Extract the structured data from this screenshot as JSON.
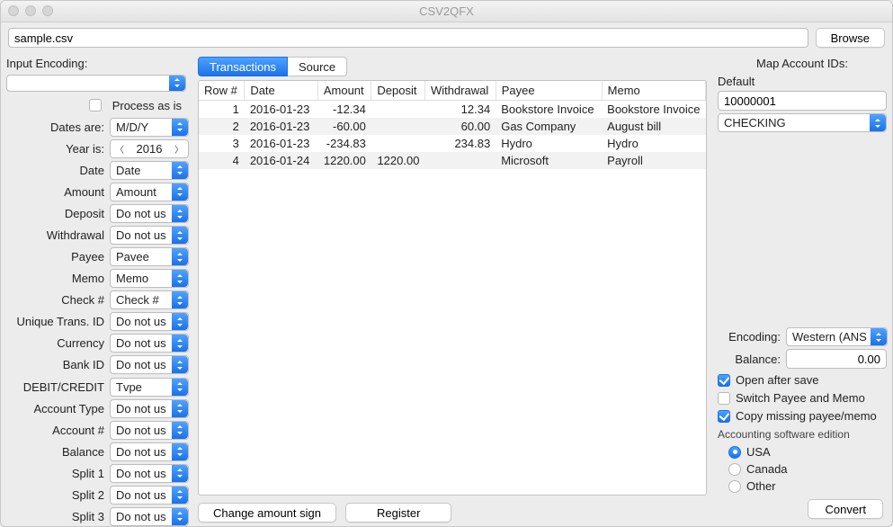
{
  "window": {
    "title": "CSV2QFX"
  },
  "top": {
    "file_path": "sample.csv",
    "browse": "Browse"
  },
  "left": {
    "input_encoding_label": "Input Encoding:",
    "process_as_is_label": "Process as is",
    "process_as_is_checked": false,
    "fields": {
      "dates_are": {
        "label": "Dates are:",
        "value": "M/D/Y"
      },
      "year_is": {
        "label": "Year is:",
        "value": "2016"
      },
      "date": {
        "label": "Date",
        "value": "Date"
      },
      "amount": {
        "label": "Amount",
        "value": "Amount"
      },
      "deposit": {
        "label": "Deposit",
        "value": "Do not us"
      },
      "withdrawal": {
        "label": "Withdrawal",
        "value": "Do not us"
      },
      "payee": {
        "label": "Payee",
        "value": "Pavee"
      },
      "memo": {
        "label": "Memo",
        "value": "Memo"
      },
      "check_no": {
        "label": "Check #",
        "value": "Check #"
      },
      "unique_trans_id": {
        "label": "Unique Trans. ID",
        "value": "Do not us"
      },
      "currency": {
        "label": "Currency",
        "value": "Do not us"
      },
      "bank_id": {
        "label": "Bank ID",
        "value": "Do not us"
      },
      "debit_credit": {
        "label": "DEBIT/CREDIT",
        "value": "Tvpe"
      },
      "account_type": {
        "label": "Account Type",
        "value": "Do not us"
      },
      "account_no": {
        "label": "Account #",
        "value": "Do not us"
      },
      "balance": {
        "label": "Balance",
        "value": "Do not us"
      },
      "split1": {
        "label": "Split 1",
        "value": "Do not us"
      },
      "split2": {
        "label": "Split 2",
        "value": "Do not us"
      },
      "split3": {
        "label": "Split 3",
        "value": "Do not us"
      }
    }
  },
  "tabs": {
    "transactions": "Transactions",
    "source": "Source",
    "active": "transactions"
  },
  "table": {
    "headers": [
      "Row #",
      "Date",
      "Amount",
      "Deposit",
      "Withdrawal",
      "Payee",
      "Memo"
    ],
    "rows": [
      {
        "row_no": "1",
        "date": "2016-01-23",
        "amount": "-12.34",
        "deposit": "",
        "withdrawal": "12.34",
        "payee": "Bookstore Invoice",
        "memo": "Bookstore Invoice"
      },
      {
        "row_no": "2",
        "date": "2016-01-23",
        "amount": "-60.00",
        "deposit": "",
        "withdrawal": "60.00",
        "payee": "Gas Company",
        "memo": "August bill"
      },
      {
        "row_no": "3",
        "date": "2016-01-23",
        "amount": "-234.83",
        "deposit": "",
        "withdrawal": "234.83",
        "payee": "Hydro",
        "memo": "Hydro"
      },
      {
        "row_no": "4",
        "date": "2016-01-24",
        "amount": "1220.00",
        "deposit": "1220.00",
        "withdrawal": "",
        "payee": "Microsoft",
        "memo": "Payroll"
      }
    ]
  },
  "bottom": {
    "change_sign": "Change amount sign",
    "register": "Register"
  },
  "right": {
    "heading": "Map Account IDs:",
    "default_label": "Default",
    "account_id": "10000001",
    "account_type": "CHECKING",
    "encoding_label": "Encoding:",
    "encoding_value": "Western (ANS",
    "balance_label": "Balance:",
    "balance_value": "0.00",
    "open_after_save": {
      "label": "Open after save",
      "checked": true
    },
    "switch_payee_memo": {
      "label": "Switch Payee and Memo",
      "checked": false
    },
    "copy_missing": {
      "label": "Copy missing payee/memo",
      "checked": true
    },
    "software_section": "Accounting software edition",
    "radios": {
      "usa": "USA",
      "canada": "Canada",
      "other": "Other",
      "selected": "usa"
    },
    "convert": "Convert"
  }
}
